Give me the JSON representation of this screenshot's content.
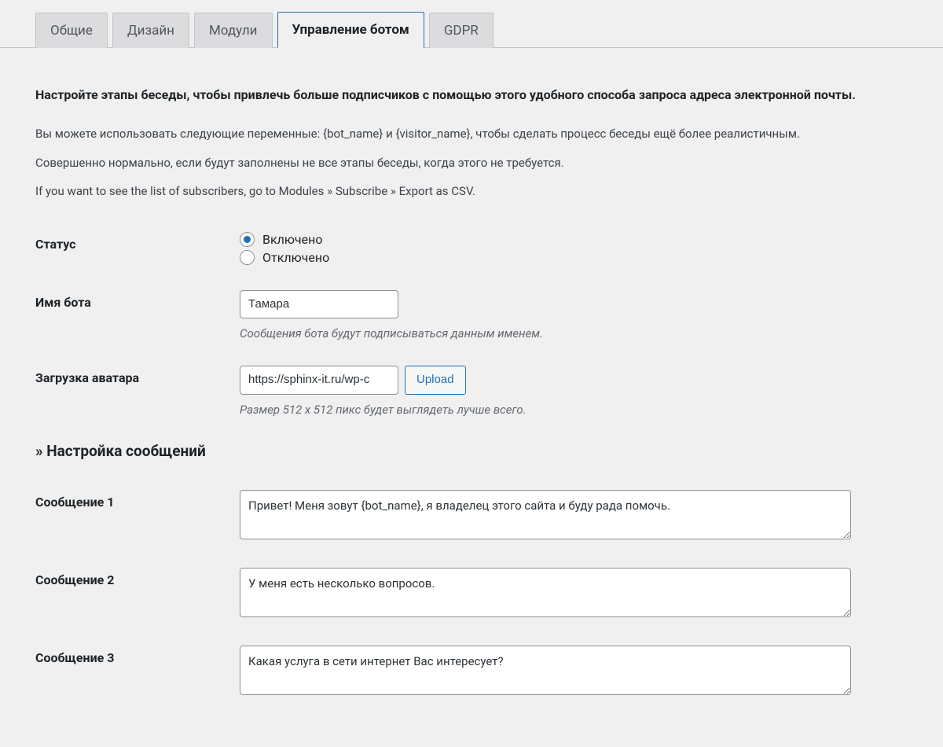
{
  "tabs": {
    "general": "Общие",
    "design": "Дизайн",
    "modules": "Модули",
    "bot_control": "Управление ботом",
    "gdpr": "GDPR"
  },
  "intro": {
    "heading": "Настройте этапы беседы, чтобы привлечь больше подписчиков с помощью этого удобного способа запроса адреса электронной почты.",
    "line1": "Вы можете использовать следующие переменные: {bot_name} и {visitor_name}, чтобы сделать процесс беседы ещё более реалистичным.",
    "line2": "Совершенно нормально, если будут заполнены не все этапы беседы, когда этого не требуется.",
    "line3": "If you want to see the list of subscribers, go to Modules » Subscribe » Export as CSV."
  },
  "status": {
    "label": "Статус",
    "enabled": "Включено",
    "disabled": "Отключено"
  },
  "bot_name": {
    "label": "Имя бота",
    "value": "Тамара",
    "help": "Сообщения бота будут подписываться данным именем."
  },
  "avatar": {
    "label": "Загрузка аватара",
    "value": "https://sphinx-it.ru/wp-c",
    "upload_btn": "Upload",
    "help": "Размер 512 х 512 пикс будет выглядеть лучше всего."
  },
  "messages_section": {
    "header": "» Настройка сообщений",
    "msg1_label": "Сообщение 1",
    "msg1_value": "Привет! Меня зовут {bot_name}, я владелец этого сайта и буду рада помочь.",
    "msg2_label": "Сообщение 2",
    "msg2_value": "У меня есть несколько вопросов.",
    "msg3_label": "Сообщение 3",
    "msg3_value": "Какая услуга в сети интернет Вас интересует?"
  }
}
